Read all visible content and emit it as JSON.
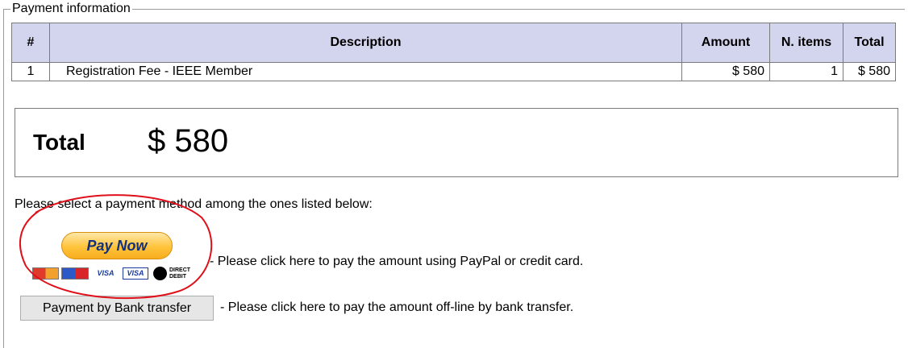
{
  "section": {
    "legend": "Payment information"
  },
  "table": {
    "headers": [
      "#",
      "Description",
      "Amount",
      "N. items",
      "Total"
    ],
    "rows": [
      {
        "num": "1",
        "description": "Registration Fee - IEEE Member",
        "amount": "$ 580",
        "items": "1",
        "total": "$ 580"
      }
    ]
  },
  "total": {
    "label": "Total",
    "value": "$ 580"
  },
  "payment": {
    "prompt": "Please select a payment method among the ones listed below:",
    "paypal": {
      "button_label": "Pay Now",
      "cards": [
        "VISA",
        "VISA",
        "DIRECT DEBIT"
      ],
      "description": "- Please click here to pay the amount using PayPal or credit card."
    },
    "bank": {
      "button_label": "Payment by Bank transfer",
      "description": "- Please click here to pay the amount off-line by bank transfer."
    }
  },
  "annotation_color": "#e0101a"
}
